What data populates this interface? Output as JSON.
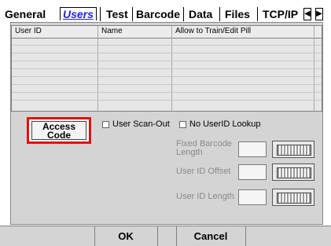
{
  "tabs": [
    {
      "label": "General"
    },
    {
      "label": "Users",
      "active": true
    },
    {
      "label": "Test"
    },
    {
      "label": "Barcode"
    },
    {
      "label": "Data"
    },
    {
      "label": "Files"
    },
    {
      "label": "TCP/IP"
    }
  ],
  "tab_nav": {
    "prev_icon": "arrow-left-icon",
    "next_icon": "arrow-right-icon"
  },
  "grid": {
    "columns": [
      "User ID",
      "Name",
      "Allow to Train/Edit Pill"
    ],
    "rows": []
  },
  "access_code": {
    "line1": "Access",
    "line2": "Code"
  },
  "checkboxes": {
    "user_scan_out": "User Scan-Out",
    "no_userid_lookup": "No UserID Lookup"
  },
  "fields": {
    "fixed_barcode_length": {
      "label_line1": "Fixed Barcode",
      "label_line2": "Length",
      "value": ""
    },
    "user_id_offset": {
      "label": "User ID Offset",
      "value": ""
    },
    "user_id_length": {
      "label": "User ID Length",
      "value": ""
    }
  },
  "keyboard_icon": "keyboard-icon",
  "footer": {
    "ok": "OK",
    "cancel": "Cancel"
  },
  "colors": {
    "active_tab": "#2222dd",
    "highlight": "#e01010",
    "panel": "#d4d4d4"
  }
}
